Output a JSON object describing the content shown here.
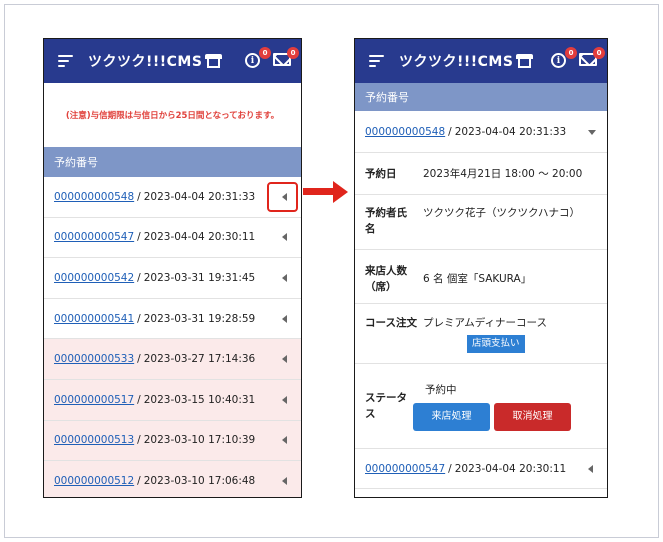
{
  "app": {
    "logo_text": "ツクツク!!!CMS",
    "info_badge": "0",
    "mail_badge": "0"
  },
  "left": {
    "notice": "(注意)与信期限は与信日から25日間となっております。",
    "section_title": "予約番号",
    "rows": [
      {
        "id": "000000000548",
        "datetime": "2023-04-04 20:31:33",
        "pink": false
      },
      {
        "id": "000000000547",
        "datetime": "2023-04-04 20:30:11",
        "pink": false
      },
      {
        "id": "000000000542",
        "datetime": "2023-03-31 19:31:45",
        "pink": false
      },
      {
        "id": "000000000541",
        "datetime": "2023-03-31 19:28:59",
        "pink": false
      },
      {
        "id": "000000000533",
        "datetime": "2023-03-27 17:14:36",
        "pink": true
      },
      {
        "id": "000000000517",
        "datetime": "2023-03-15 10:40:31",
        "pink": true
      },
      {
        "id": "000000000513",
        "datetime": "2023-03-10 17:10:39",
        "pink": true
      },
      {
        "id": "000000000512",
        "datetime": "2023-03-10 17:06:48",
        "pink": true
      }
    ]
  },
  "right": {
    "section_title": "予約番号",
    "expanded_row": {
      "id": "000000000548",
      "datetime": "2023-04-04 20:31:33"
    },
    "details": {
      "date_label": "予約日",
      "date_value": "2023年4月21日 18:00 〜 20:00",
      "name_label": "予約者氏名",
      "name_value": "ツクツク花子（ツクツクハナコ）",
      "guests_label": "来店人数（席）",
      "guests_value": "6 名 個室「SAKURA」",
      "course_label": "コース注文",
      "course_value": "プレミアムディナーコース",
      "payment_tag": "店頭支払い",
      "status_label": "ステータス",
      "status_value": "予約中",
      "visit_button": "来店処理",
      "cancel_button": "取消処理"
    },
    "next_row": {
      "id": "000000000547",
      "datetime": "2023-04-04 20:30:11"
    }
  },
  "colors": {
    "header_bg": "#283a8e",
    "section_bg": "#7e96c7",
    "link": "#1f5fb7",
    "notice": "#e0413b",
    "pink_row": "#fbeaea",
    "accent_red": "#e0251c",
    "button_blue": "#2d7fd3",
    "button_red": "#c92a2a"
  }
}
